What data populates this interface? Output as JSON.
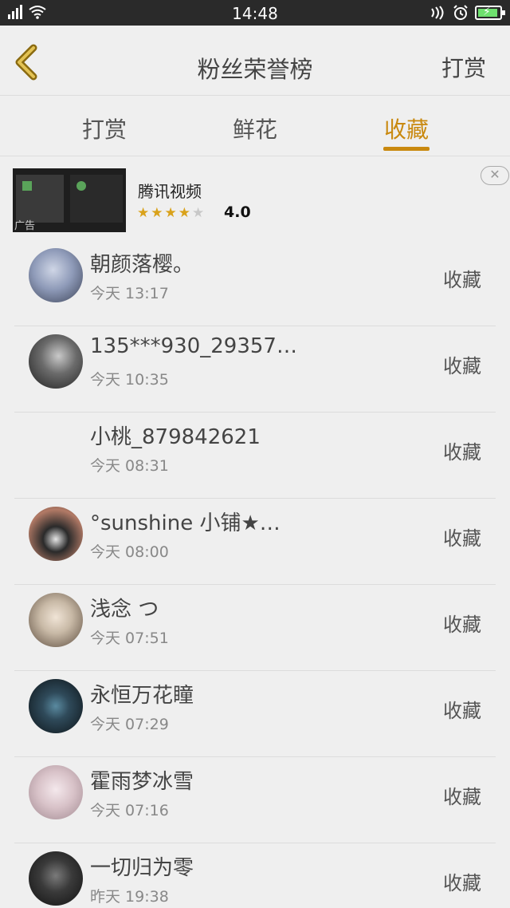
{
  "status_bar": {
    "time": "14:48"
  },
  "nav": {
    "title": "粉丝荣誉榜",
    "action": "打赏"
  },
  "tabs": [
    {
      "label": "打赏",
      "active": false
    },
    {
      "label": "鲜花",
      "active": false
    },
    {
      "label": "收藏",
      "active": true
    }
  ],
  "ad": {
    "tag": "广告",
    "app_name": "腾讯视频",
    "rating": "4.0",
    "stars": 4,
    "close_symbol": "✕"
  },
  "fans": [
    {
      "name": "朝颜落樱。",
      "time": "今天 13:17",
      "action": "收藏",
      "avatar_color": "#8e9ab8"
    },
    {
      "name": "135***930_29357…",
      "time": "今天 10:35",
      "action": "收藏",
      "avatar_color": "#5b5b5b"
    },
    {
      "name": "小桃_879842621",
      "time": "今天 08:31",
      "action": "收藏",
      "avatar_color": ""
    },
    {
      "name": "°sunshine 小铺★…",
      "time": "今天 08:00",
      "action": "收藏",
      "avatar_color": "#b27a66"
    },
    {
      "name": "浅念 つ",
      "time": "今天 07:51",
      "action": "收藏",
      "avatar_color": "#c8b9a6"
    },
    {
      "name": "永恒万花瞳",
      "time": "今天 07:29",
      "action": "收藏",
      "avatar_color": "#2f4a5a"
    },
    {
      "name": "霍雨梦冰雪",
      "time": "今天 07:16",
      "action": "收藏",
      "avatar_color": "#d8c2c8"
    },
    {
      "name": "一切归为零",
      "time": "昨天 19:38",
      "action": "收藏",
      "avatar_color": "#3a3a3a"
    }
  ],
  "colors": {
    "accent": "#c9890f",
    "status_bar": "#2a2a2a",
    "background": "#efefef"
  }
}
